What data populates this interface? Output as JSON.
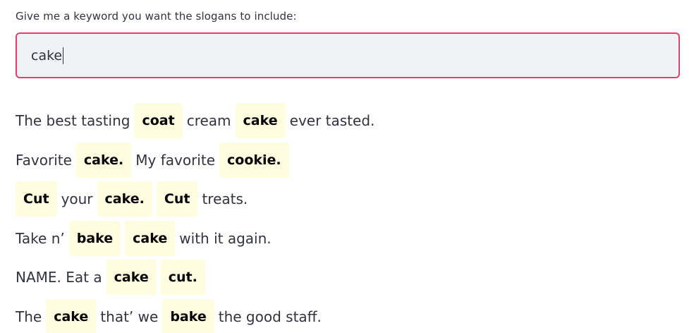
{
  "prompt": {
    "label": "Give me a keyword you want the slogans to include:",
    "value": "cake"
  },
  "colors": {
    "input_border": "#e0426e",
    "input_bg": "#f0f2f6",
    "highlight_bg": "#fffde0"
  },
  "slogans": [
    {
      "tokens": [
        {
          "text": "The best tasting",
          "highlight": false
        },
        {
          "text": "coat",
          "highlight": true
        },
        {
          "text": "cream",
          "highlight": false
        },
        {
          "text": "cake",
          "highlight": true
        },
        {
          "text": "ever tasted.",
          "highlight": false
        }
      ]
    },
    {
      "tokens": [
        {
          "text": "Favorite",
          "highlight": false
        },
        {
          "text": "cake.",
          "highlight": true
        },
        {
          "text": "My favorite",
          "highlight": false
        },
        {
          "text": "cookie.",
          "highlight": true
        }
      ]
    },
    {
      "tokens": [
        {
          "text": "Cut",
          "highlight": true
        },
        {
          "text": "your",
          "highlight": false
        },
        {
          "text": "cake.",
          "highlight": true
        },
        {
          "text": "Cut",
          "highlight": true
        },
        {
          "text": "treats.",
          "highlight": false
        }
      ]
    },
    {
      "tokens": [
        {
          "text": "Take n’",
          "highlight": false
        },
        {
          "text": "bake",
          "highlight": true
        },
        {
          "text": "cake",
          "highlight": true
        },
        {
          "text": "with it again.",
          "highlight": false
        }
      ]
    },
    {
      "tokens": [
        {
          "text": "NAME. Eat a",
          "highlight": false
        },
        {
          "text": "cake",
          "highlight": true
        },
        {
          "text": "cut.",
          "highlight": true
        }
      ]
    },
    {
      "tokens": [
        {
          "text": "The",
          "highlight": false
        },
        {
          "text": "cake",
          "highlight": true
        },
        {
          "text": "that’ we",
          "highlight": false
        },
        {
          "text": "bake",
          "highlight": true
        },
        {
          "text": "the good staff.",
          "highlight": false
        }
      ]
    }
  ]
}
